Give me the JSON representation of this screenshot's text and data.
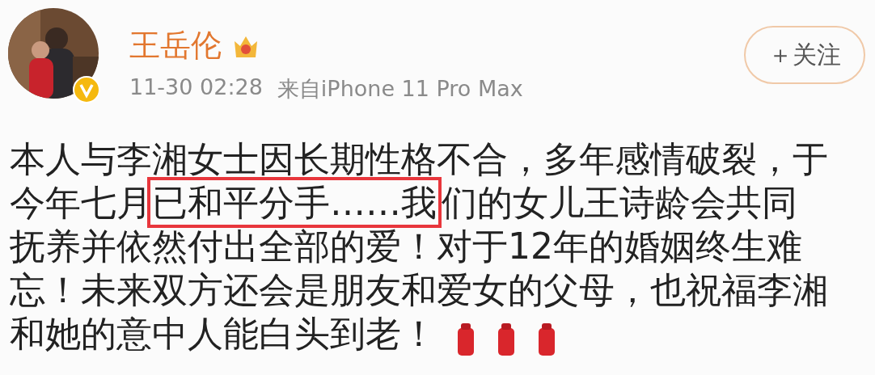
{
  "author": {
    "verified": true,
    "name": "王岳伦",
    "member_badge": true
  },
  "meta": {
    "time": "11-30 02:28",
    "source": "来自iPhone 11 Pro Max"
  },
  "follow_button": {
    "label": "＋关注"
  },
  "body": [
    {
      "text": "本人与李湘女士因长期性格不合，多年感情破裂，于今年七月",
      "highlighted": false
    },
    {
      "text": "已和平分手……我",
      "highlighted": true
    },
    {
      "text": "们的女儿王诗龄会共同抚养并依然付出全部的爱！对于12年的婚姻终生难忘！未来双方还会是朋友和爱女的父母，也祝福李湘和她的意中人能白头到老！",
      "highlighted": false
    }
  ]
}
